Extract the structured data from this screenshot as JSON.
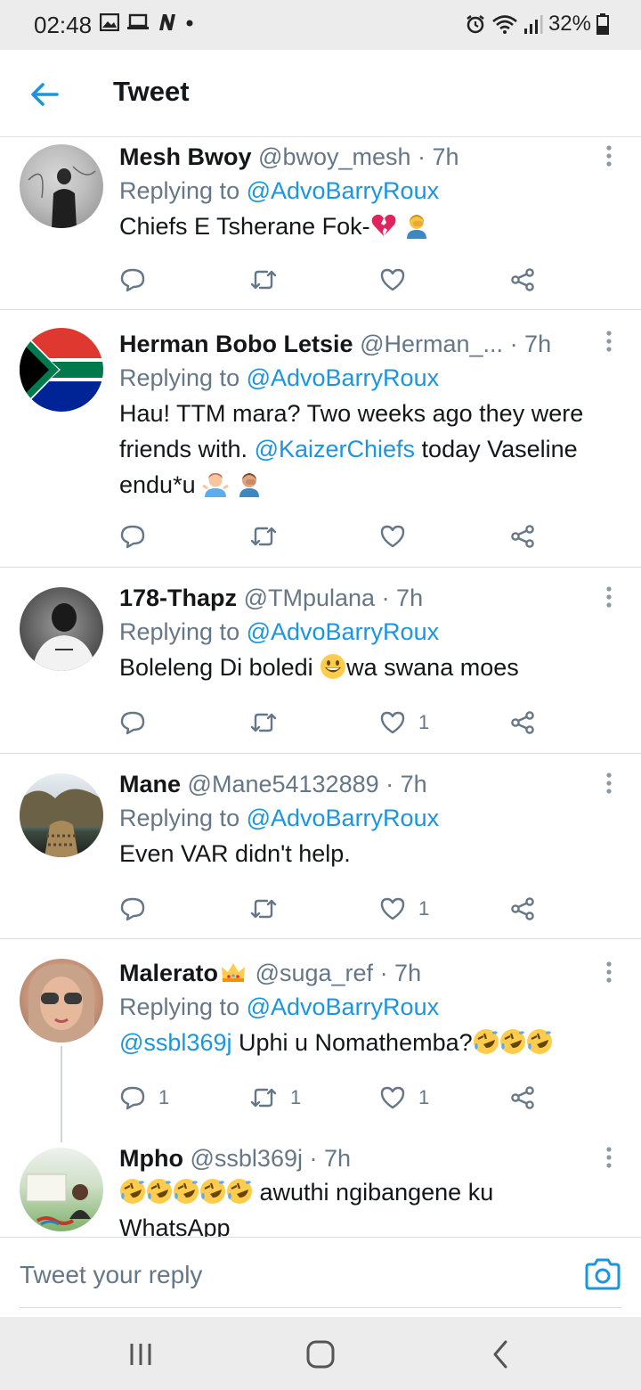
{
  "status_bar": {
    "time": "02:48",
    "battery": "32%",
    "icons": [
      "image-icon",
      "laptop-icon",
      "n-icon",
      "dot-icon",
      "alarm-icon",
      "wifi-icon",
      "signal-icon",
      "battery-icon"
    ]
  },
  "header": {
    "title": "Tweet",
    "back_icon": "arrow-left-icon"
  },
  "tweets": [
    {
      "name": "Mesh Bwoy",
      "handle": "@bwoy_mesh",
      "time": "· 7h",
      "replying_prefix": "Replying to ",
      "replying_to": "@AdvoBarryRoux",
      "text": "Chiefs E Tsherane Fok-",
      "emojis": [
        "broken-heart-emoji",
        "person-facepalming-emoji"
      ],
      "counts": {
        "reply": "",
        "retweet": "",
        "like": ""
      }
    },
    {
      "name": "Herman Bobo Letsie",
      "handle": "@Herman_...",
      "time": "· 7h",
      "replying_prefix": "Replying to ",
      "replying_to": "@AdvoBarryRoux",
      "text_1": "Hau! TTM mara?  Two weeks ago they were friends with. ",
      "mention": "@KaizerChiefs",
      "text_2": " today Vaseline endu*u ",
      "emojis": [
        "person-shrugging-emoji",
        "person-facepalming-emoji"
      ],
      "counts": {
        "reply": "",
        "retweet": "",
        "like": ""
      }
    },
    {
      "name": "178-Thapz",
      "handle": "@TMpulana",
      "time": "· 7h",
      "replying_prefix": "Replying to ",
      "replying_to": "@AdvoBarryRoux",
      "text_1": "Boleleng Di boledi ",
      "text_2": "wa swana moes",
      "emojis": [
        "grinning-face-emoji"
      ],
      "counts": {
        "reply": "",
        "retweet": "",
        "like": "1"
      }
    },
    {
      "name": "Mane",
      "handle": "@Mane54132889",
      "time": "· 7h",
      "replying_prefix": "Replying to ",
      "replying_to": "@AdvoBarryRoux",
      "text": "Even VAR didn't help.",
      "counts": {
        "reply": "",
        "retweet": "",
        "like": "1"
      }
    },
    {
      "name": "Malerato",
      "handle": "@suga_ref",
      "time": "· 7h",
      "replying_prefix": "Replying to ",
      "replying_to": "@AdvoBarryRoux",
      "mention": "@ssbl369j",
      "text": " Uphi u Nomathemba?",
      "emojis": [
        "crown-emoji",
        "rolling-laughing-emoji",
        "rolling-laughing-emoji",
        "rolling-laughing-emoji"
      ],
      "counts": {
        "reply": "1",
        "retweet": "1",
        "like": "1"
      }
    },
    {
      "name": "Mpho",
      "handle": "@ssbl369j",
      "time": "· 7h",
      "text": " awuthi ngibangene ku WhatsApp",
      "emojis": [
        "rolling-laughing-emoji",
        "rolling-laughing-emoji",
        "rolling-laughing-emoji",
        "rolling-laughing-emoji",
        "rolling-laughing-emoji"
      ]
    }
  ],
  "reply_bar": {
    "placeholder": "Tweet your reply",
    "camera_icon": "camera-icon"
  },
  "nav_bar": {
    "icons": [
      "recent-apps-icon",
      "home-icon",
      "back-icon"
    ]
  },
  "colors": {
    "accent": "#1b95e0",
    "secondary_text": "#657786",
    "primary_text": "#14171a",
    "divider": "#d9dde0",
    "system_bar": "#ececec"
  }
}
